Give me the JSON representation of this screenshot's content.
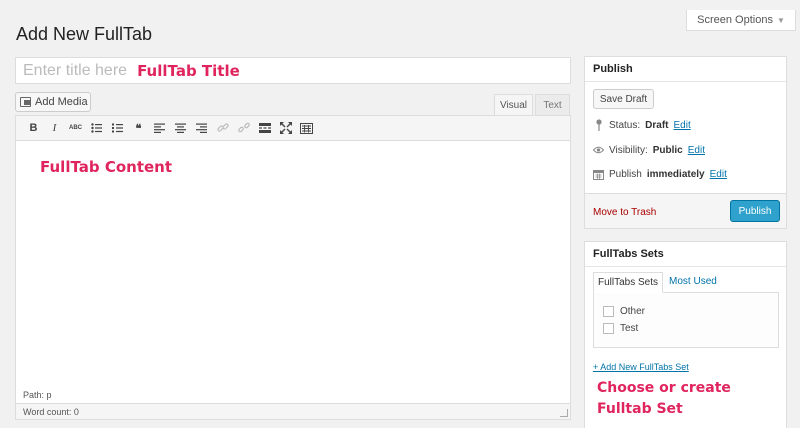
{
  "header": {
    "screen_options": "Screen Options",
    "page_title": "Add New FullTab"
  },
  "title_field": {
    "placeholder": "Enter title here",
    "annotation": "FullTab Title"
  },
  "editor": {
    "add_media": "Add Media",
    "tabs": {
      "visual": "Visual",
      "text": "Text"
    },
    "toolbar": [
      "bold-icon",
      "italic-icon",
      "strikethrough-icon",
      "bullet-list-icon",
      "numbered-list-icon",
      "blockquote-icon",
      "align-left-icon",
      "align-center-icon",
      "align-right-icon",
      "link-icon",
      "unlink-icon",
      "read-more-icon",
      "fullscreen-icon",
      "kitchen-sink-icon"
    ],
    "content_annotation": "FullTab Content",
    "path": "Path: p",
    "word_count": "Word count: 0"
  },
  "publish": {
    "title": "Publish",
    "save_draft": "Save Draft",
    "status_label": "Status:",
    "status_value": "Draft",
    "visibility_label": "Visibility:",
    "visibility_value": "Public",
    "publish_label": "Publish",
    "publish_value": "immediately",
    "edit": "Edit",
    "move_to_trash": "Move to Trash",
    "publish_button": "Publish"
  },
  "sets": {
    "title": "FullTabs Sets",
    "tab_all": "FullTabs Sets",
    "tab_used": "Most Used",
    "items": [
      "Other",
      "Test"
    ],
    "add_new": "+ Add New FullTabs Set",
    "annotation_line1": "Choose or create",
    "annotation_line2": "Fulltab Set"
  },
  "colors": {
    "accent": "#2ea2cc",
    "link": "#0073aa",
    "annotation": "#e0245e",
    "trash": "#aa0000"
  }
}
